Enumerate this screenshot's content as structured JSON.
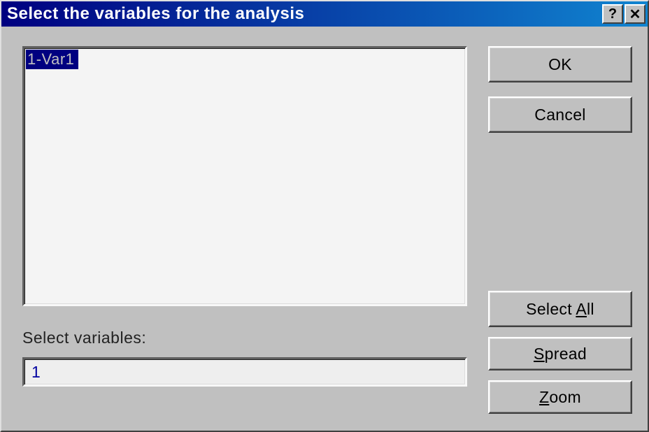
{
  "title": "Select the variables for the analysis",
  "titlebar": {
    "help_symbol": "?",
    "close_symbol": "✕"
  },
  "listbox": {
    "items": [
      "1-Var1"
    ]
  },
  "select_label": "Select variables:",
  "select_value": "1",
  "buttons": {
    "ok": "OK",
    "cancel": "Cancel",
    "select_all_pre": "Select ",
    "select_all_u": "A",
    "select_all_post": "ll",
    "spread_u": "S",
    "spread_post": "pread",
    "zoom_u": "Z",
    "zoom_post": "oom"
  }
}
